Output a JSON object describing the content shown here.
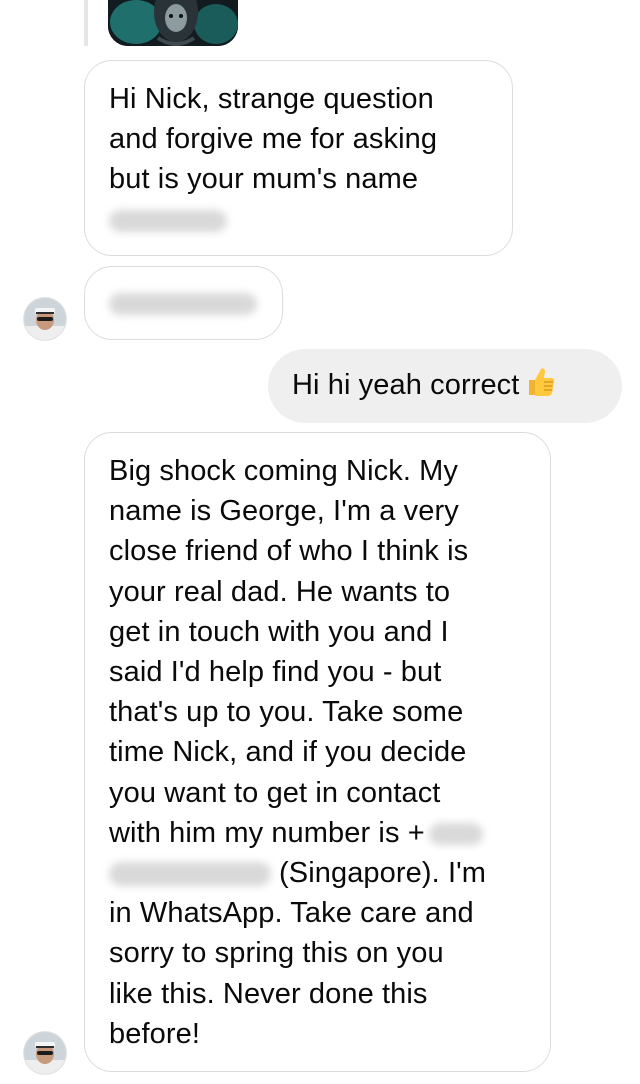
{
  "thread": {
    "sender_name": "George",
    "recipient_name": "Nick"
  },
  "messages": [
    {
      "direction": "incoming",
      "lines": [
        "Hi Nick, strange question",
        "and forgive me for asking",
        "but is your mum's name"
      ],
      "redacted_tail": true
    },
    {
      "direction": "incoming",
      "lines": [],
      "redacted_tail": true
    },
    {
      "direction": "outgoing",
      "text": "Hi hi yeah correct",
      "emoji": "thumbs-up"
    },
    {
      "direction": "incoming",
      "lines": [
        "Big shock coming Nick. My",
        "name is George, I'm a very",
        "close friend of who I think is",
        "your real dad. He wants to",
        "get in touch with you and I",
        "said I'd help find you - but",
        "that's up to you. Take some",
        "time Nick, and if you decide",
        "you want to get in contact",
        "with him my number is +",
        "(Singapore). I'm",
        "in WhatsApp. Take care and",
        "sorry to spring this on you",
        "like this. Never done this",
        "before!"
      ]
    }
  ],
  "colors": {
    "incoming_border": "#dcdcdc",
    "outgoing_fill": "#efefef",
    "text": "#0a0a0a"
  }
}
